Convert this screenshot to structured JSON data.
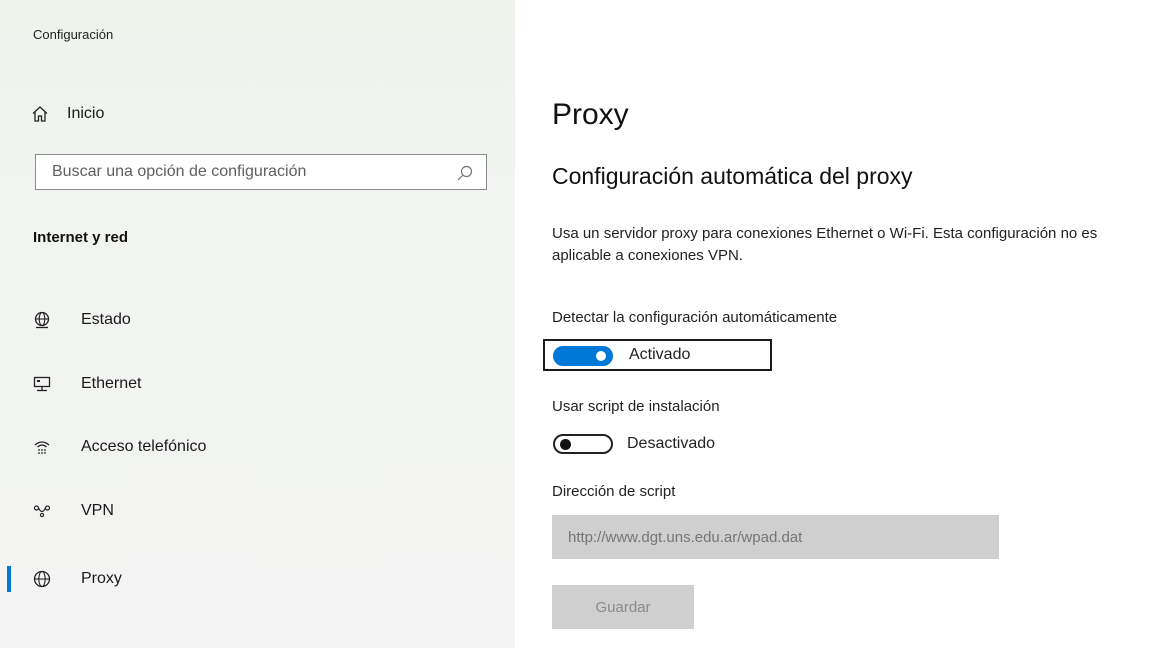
{
  "sidebar": {
    "app_title": "Configuración",
    "home_label": "Inicio",
    "search_placeholder": "Buscar una opción de configuración",
    "section_title": "Internet y red",
    "items": [
      {
        "label": "Estado",
        "icon": "globe-status-icon"
      },
      {
        "label": "Ethernet",
        "icon": "ethernet-icon"
      },
      {
        "label": "Acceso telefónico",
        "icon": "dialup-icon"
      },
      {
        "label": "VPN",
        "icon": "vpn-icon"
      },
      {
        "label": "Proxy",
        "icon": "globe-icon",
        "selected": true
      }
    ]
  },
  "main": {
    "title": "Proxy",
    "subtitle": "Configuración automática del proxy",
    "description": "Usa un servidor proxy para conexiones Ethernet o Wi-Fi. Esta configuración no es aplicable a conexiones VPN.",
    "auto_detect": {
      "label": "Detectar la configuración automáticamente",
      "state": "Activado",
      "on": true
    },
    "use_script": {
      "label": "Usar script de instalación",
      "state": "Desactivado",
      "on": false
    },
    "script_address": {
      "label": "Dirección de script",
      "placeholder": "http://www.dgt.uns.edu.ar/wpad.dat"
    },
    "save_label": "Guardar"
  },
  "colors": {
    "accent": "#0078d7",
    "disabled_bg": "#cfcfcf",
    "sidebar_bg": "#f2f4f1"
  }
}
